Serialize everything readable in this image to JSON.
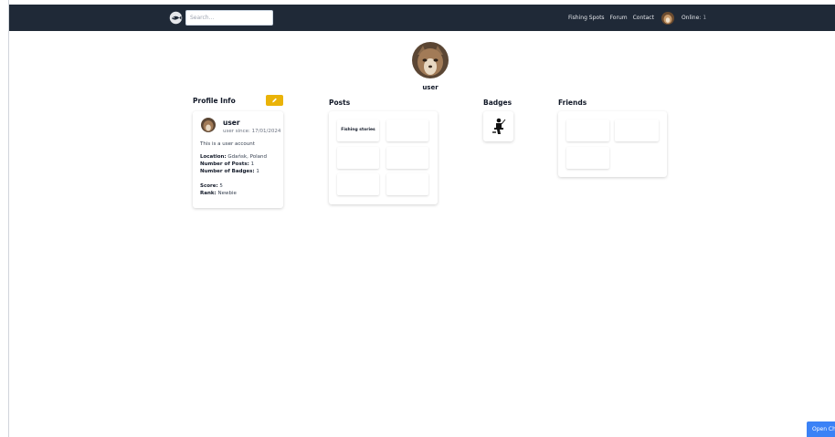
{
  "navbar": {
    "logo_icon": "fish-logo-icon",
    "search": {
      "placeholder": "Search...",
      "value": ""
    },
    "links": {
      "fishing_spots": "Fishing Spots",
      "forum": "Forum",
      "contact": "Contact"
    },
    "online_label": "Online:",
    "online_count": "1"
  },
  "profile": {
    "username": "user"
  },
  "sections": {
    "profile_info": "Profile Info",
    "posts": "Posts",
    "badges": "Badges",
    "friends": "Friends"
  },
  "profile_card": {
    "name": "user",
    "since": "user since: 17/01/2024",
    "bio": "This is a user account",
    "location_label": "Location:",
    "location": "Gdańsk, Poland",
    "posts_label": "Number of Posts:",
    "posts": "1",
    "badges_label": "Number of Badges:",
    "badges": "1",
    "score_label": "Score:",
    "score": "5",
    "rank_label": "Rank:",
    "rank": "Newbie"
  },
  "posts": {
    "items": [
      {
        "title": "Fishing stories"
      },
      {
        "title": ""
      },
      {
        "title": ""
      },
      {
        "title": ""
      },
      {
        "title": ""
      },
      {
        "title": ""
      }
    ]
  },
  "badges": {
    "items": [
      {
        "icon": "fisherman-badge-icon"
      }
    ]
  },
  "friends": {
    "items": [
      {},
      {},
      {}
    ]
  },
  "chat": {
    "button_label": "Open Chat"
  },
  "colors": {
    "navbar": "#1f2937",
    "edit_button": "#eab308",
    "chat_button": "#3b82f6"
  }
}
